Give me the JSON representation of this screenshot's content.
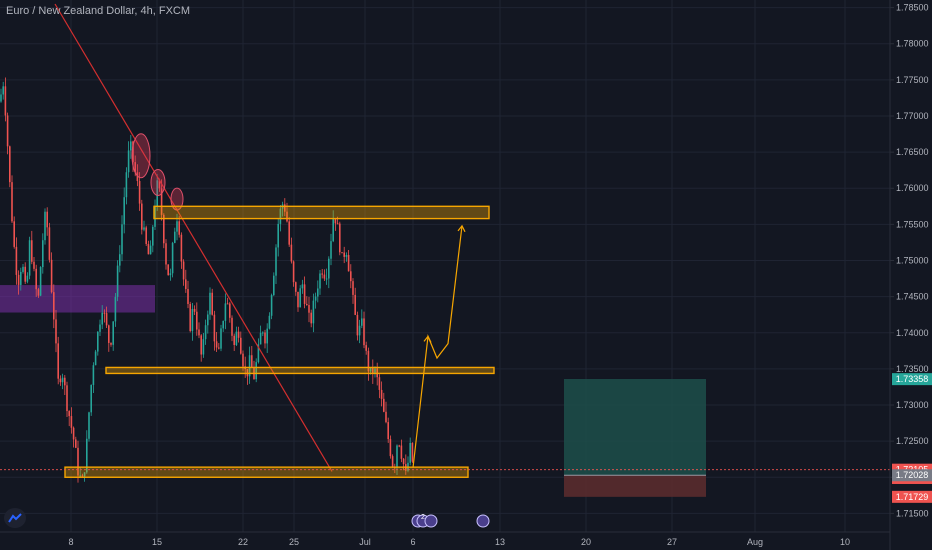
{
  "title": "Euro / New Zealand Dollar, 4h, FXCM",
  "colors": {
    "background": "#131722",
    "up": "#26a69a",
    "down": "#ef5350",
    "zone": "#f7a600",
    "purple_zone": "#7b2fa8",
    "trendline": "#d32f2f",
    "target_box": "#1d4f4a",
    "stop_box": "#5a2b2e",
    "projection": "#f7a600"
  },
  "chart_data": {
    "type": "candlestick",
    "symbol": "Euro / New Zealand Dollar",
    "interval": "4h",
    "source": "FXCM",
    "y_ticks": [
      1.785,
      1.78,
      1.775,
      1.77,
      1.765,
      1.76,
      1.755,
      1.75,
      1.745,
      1.74,
      1.735,
      1.73,
      1.725,
      1.72,
      1.715
    ],
    "y_tick_labels": [
      "1.78500",
      "1.78000",
      "1.77500",
      "1.77000",
      "1.76500",
      "1.76000",
      "1.75500",
      "1.75000",
      "1.74500",
      "1.74000",
      "1.73500",
      "1.73000",
      "1.72500",
      "1.72000",
      "1.71500"
    ],
    "ylim": [
      1.7145,
      1.7855
    ],
    "x_ticks": [
      "8",
      "15",
      "22",
      "25",
      "Jul",
      "6",
      "13",
      "20",
      "27",
      "Aug",
      "10"
    ],
    "price_path": [
      [
        0,
        1.772
      ],
      [
        3,
        1.775
      ],
      [
        6,
        1.77
      ],
      [
        10,
        1.76
      ],
      [
        14,
        1.752
      ],
      [
        18,
        1.747
      ],
      [
        22,
        1.75
      ],
      [
        26,
        1.745
      ],
      [
        30,
        1.753
      ],
      [
        34,
        1.748
      ],
      [
        38,
        1.744
      ],
      [
        42,
        1.752
      ],
      [
        46,
        1.757
      ],
      [
        50,
        1.749
      ],
      [
        54,
        1.742
      ],
      [
        58,
        1.733
      ],
      [
        62,
        1.735
      ],
      [
        66,
        1.731
      ],
      [
        70,
        1.728
      ],
      [
        74,
        1.725
      ],
      [
        78,
        1.721
      ],
      [
        82,
        1.719
      ],
      [
        86,
        1.723
      ],
      [
        90,
        1.731
      ],
      [
        94,
        1.737
      ],
      [
        98,
        1.74
      ],
      [
        102,
        1.744
      ],
      [
        106,
        1.741
      ],
      [
        110,
        1.738
      ],
      [
        114,
        1.743
      ],
      [
        118,
        1.749
      ],
      [
        122,
        1.755
      ],
      [
        126,
        1.762
      ],
      [
        130,
        1.766
      ],
      [
        134,
        1.763
      ],
      [
        138,
        1.76
      ],
      [
        142,
        1.755
      ],
      [
        146,
        1.752
      ],
      [
        150,
        1.75
      ],
      [
        154,
        1.757
      ],
      [
        158,
        1.761
      ],
      [
        162,
        1.756
      ],
      [
        166,
        1.75
      ],
      [
        170,
        1.747
      ],
      [
        174,
        1.754
      ],
      [
        178,
        1.757
      ],
      [
        182,
        1.749
      ],
      [
        186,
        1.745
      ],
      [
        190,
        1.741
      ],
      [
        194,
        1.744
      ],
      [
        198,
        1.74
      ],
      [
        202,
        1.736
      ],
      [
        206,
        1.742
      ],
      [
        210,
        1.745
      ],
      [
        214,
        1.74
      ],
      [
        218,
        1.736
      ],
      [
        222,
        1.741
      ],
      [
        226,
        1.745
      ],
      [
        230,
        1.742
      ],
      [
        234,
        1.738
      ],
      [
        238,
        1.741
      ],
      [
        242,
        1.737
      ],
      [
        246,
        1.734
      ],
      [
        250,
        1.736
      ],
      [
        254,
        1.734
      ],
      [
        258,
        1.737
      ],
      [
        262,
        1.741
      ],
      [
        266,
        1.739
      ],
      [
        270,
        1.744
      ],
      [
        274,
        1.749
      ],
      [
        278,
        1.755
      ],
      [
        282,
        1.758
      ],
      [
        286,
        1.757
      ],
      [
        290,
        1.751
      ],
      [
        294,
        1.746
      ],
      [
        298,
        1.744
      ],
      [
        302,
        1.747
      ],
      [
        306,
        1.744
      ],
      [
        310,
        1.741
      ],
      [
        314,
        1.744
      ],
      [
        318,
        1.747
      ],
      [
        322,
        1.749
      ],
      [
        326,
        1.748
      ],
      [
        330,
        1.752
      ],
      [
        334,
        1.757
      ],
      [
        338,
        1.754
      ],
      [
        342,
        1.75
      ],
      [
        346,
        1.752
      ],
      [
        350,
        1.748
      ],
      [
        354,
        1.743
      ],
      [
        358,
        1.74
      ],
      [
        362,
        1.741
      ],
      [
        366,
        1.737
      ],
      [
        370,
        1.734
      ],
      [
        374,
        1.735
      ],
      [
        378,
        1.733
      ],
      [
        382,
        1.73
      ],
      [
        386,
        1.727
      ],
      [
        390,
        1.724
      ],
      [
        394,
        1.721
      ],
      [
        398,
        1.726
      ],
      [
        402,
        1.723
      ],
      [
        406,
        1.72
      ],
      [
        410,
        1.724
      ],
      [
        414,
        1.721
      ]
    ],
    "last_price": 1.72105,
    "countdown": "01:29:24",
    "horizontal_zones": [
      {
        "x0": 154,
        "x1": 489,
        "y_top": 1.7575,
        "y_bottom": 1.7558,
        "color": "orange"
      },
      {
        "x0": 106,
        "x1": 494,
        "y_top": 1.7352,
        "y_bottom": 1.7344,
        "color": "orange"
      },
      {
        "x0": 65,
        "x1": 468,
        "y_top": 1.7214,
        "y_bottom": 1.72,
        "color": "orange"
      },
      {
        "x0": 0,
        "x1": 155,
        "y_top": 1.7466,
        "y_bottom": 1.7428,
        "color": "purple"
      }
    ],
    "trendline": {
      "x0": 55,
      "y0": 1.7855,
      "x1": 332,
      "y1": 1.7208
    },
    "ellipses": [
      {
        "cx": 141,
        "cy": 1.7645,
        "rx": 9,
        "ry": 22
      },
      {
        "cx": 158,
        "cy": 1.7608,
        "rx": 7,
        "ry": 13
      },
      {
        "cx": 177,
        "cy": 1.7585,
        "rx": 6,
        "ry": 11
      }
    ],
    "projection_path": [
      [
        413,
        1.7213
      ],
      [
        428,
        1.7395
      ],
      [
        437,
        1.7365
      ],
      [
        448,
        1.7385
      ],
      [
        462,
        1.7548
      ]
    ],
    "position": {
      "x0": 564,
      "x1": 706,
      "target_top": 1.7336,
      "entry": 1.72028,
      "stop": 1.71729
    },
    "price_tags": [
      {
        "label": "1.73358",
        "value": 1.73358,
        "color": "#26a69a"
      },
      {
        "label": "1.72105",
        "value": 1.72105,
        "color": "#ef5350"
      },
      {
        "label": "01:29:24",
        "value": 1.7199,
        "color": "#ef5350"
      },
      {
        "label": "1.72028",
        "value": 1.72028,
        "color": "#787b86"
      },
      {
        "label": "1.71729",
        "value": 1.71729,
        "color": "#ef5350"
      }
    ],
    "event_markers": [
      {
        "x": 418,
        "kind": "flag"
      },
      {
        "x": 423,
        "kind": "count",
        "label": "2"
      },
      {
        "x": 431,
        "kind": "flag"
      },
      {
        "x": 483,
        "kind": "flag"
      }
    ],
    "grid": true
  }
}
